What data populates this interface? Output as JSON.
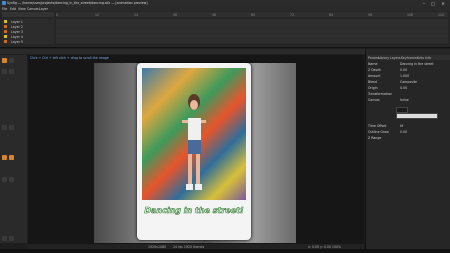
{
  "window": {
    "title": "Synfig — /home/user/projects/dancing_in_the_street/dancing.sifz — [animation preview]",
    "minimize": "–",
    "maximize": "□",
    "close": "✕"
  },
  "menu": [
    "File",
    "Edit",
    "View",
    "Canvas",
    "Layer",
    "Plug-Ins",
    "Toolbox",
    "Window",
    "Help"
  ],
  "timeline": {
    "ruler_ticks": [
      "0",
      "12",
      "24",
      "36",
      "48",
      "60",
      "72",
      "84",
      "96",
      "108",
      "120"
    ],
    "layers": [
      {
        "name": "Layer 1",
        "color": "#e0c020"
      },
      {
        "name": "Layer 2",
        "color": "#d06a20"
      },
      {
        "name": "Layer 3",
        "color": "#d06a20"
      },
      {
        "name": "Layer 4",
        "color": "#e0c020"
      },
      {
        "name": "Layer 5",
        "color": "#d06a20"
      },
      {
        "name": "Layer 6",
        "color": "#d06a20"
      }
    ]
  },
  "canvas": {
    "hint": "Click + Ctrl + left click + drag to scroll the image",
    "caption": "Dancing in the street!"
  },
  "status": {
    "left": "1920x1080",
    "center": "24 fps   1920 frames",
    "right": "x: 0.00  y: 0.00   100%"
  },
  "right_panel": {
    "tabs": [
      "Params",
      "Library",
      "Layers",
      "Keyframes",
      "Sets",
      "Info"
    ],
    "rows": [
      {
        "label": "Name",
        "value": "Dancing in the street"
      },
      {
        "label": "Z Depth",
        "value": "0.00"
      },
      {
        "label": "Amount",
        "value": "1.000"
      },
      {
        "label": "Blend",
        "value": "Composite"
      },
      {
        "label": "Origin",
        "value": "0.00"
      },
      {
        "label": "Transformation",
        "value": ""
      },
      {
        "label": "Canvas",
        "value": "Inline"
      },
      {
        "label": "Time Offset",
        "value": "0f"
      },
      {
        "label": "Outline Grow",
        "value": "0.00"
      },
      {
        "label": "Z Range",
        "value": ""
      }
    ]
  },
  "colors": {
    "accent": "#3e8ed0",
    "tool_active": "#d6862a",
    "caption_outline": "#2e7a2e"
  }
}
